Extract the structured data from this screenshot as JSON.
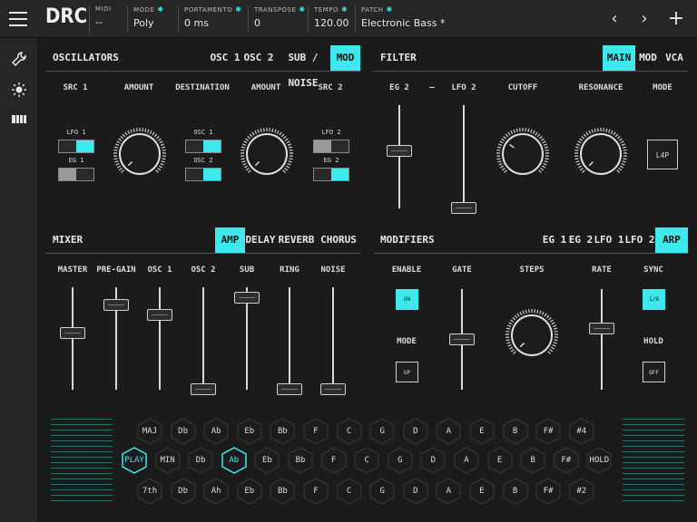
{
  "app": {
    "title": "DRC"
  },
  "header": {
    "fields": [
      {
        "label": "MIDI",
        "value": "--",
        "gear": false
      },
      {
        "label": "MODE",
        "value": "Poly",
        "gear": true
      },
      {
        "label": "PORTAMENTO",
        "value": "0 ms",
        "gear": true
      },
      {
        "label": "TRANSPOSE",
        "value": "0",
        "gear": true
      },
      {
        "label": "TEMPO",
        "value": "120.00",
        "gear": true
      },
      {
        "label": "PATCH",
        "value": "Electronic Bass *",
        "gear": true
      }
    ],
    "nav": {
      "prev": "‹",
      "next": "›",
      "add": "+"
    }
  },
  "sidebar": {
    "icons": [
      "wrench-icon",
      "brightness-icon",
      "piano-keys-icon"
    ]
  },
  "oscillators": {
    "title": "OSCILLATORS",
    "tabs": [
      "OSC 1",
      "OSC 2",
      "SUB / NOISE",
      "MOD"
    ],
    "active_tab": "MOD",
    "columns": [
      "SRC 1",
      "AMOUNT",
      "DESTINATION",
      "AMOUNT",
      "SRC 2"
    ],
    "src1": [
      {
        "label": "LFO 1",
        "on": true
      },
      {
        "label": "EG 1",
        "on": false
      }
    ],
    "dest": [
      {
        "label": "OSC 1",
        "on": true
      },
      {
        "label": "OSC 2",
        "on": true
      }
    ],
    "src2": [
      {
        "label": "LFO 2",
        "on": false
      },
      {
        "label": "EG 2",
        "on": true
      }
    ],
    "amount1": 0.0,
    "amount2": 0.0
  },
  "filter": {
    "title": "FILTER",
    "tabs": [
      "MAIN",
      "MOD",
      "VCA"
    ],
    "active_tab": "MAIN",
    "columns": [
      "EG 2",
      "—",
      "LFO 2",
      "CUTOFF",
      "RESONANCE",
      "MODE"
    ],
    "eg2": 0.55,
    "lfo2": 0.0,
    "cutoff": 0.3,
    "resonance": 0.0,
    "mode": "L4P"
  },
  "mixer": {
    "title": "MIXER",
    "tabs": [
      "AMP",
      "DELAY",
      "REVERB",
      "CHORUS"
    ],
    "active_tab": "AMP",
    "channels": [
      {
        "label": "MASTER",
        "value": 0.55
      },
      {
        "label": "PRE-GAIN",
        "value": 0.82
      },
      {
        "label": "OSC 1",
        "value": 0.73
      },
      {
        "label": "OSC 2",
        "value": 0.0
      },
      {
        "label": "SUB",
        "value": 0.89
      },
      {
        "label": "RING",
        "value": 0.0
      },
      {
        "label": "NOISE",
        "value": 0.0
      }
    ]
  },
  "modifiers": {
    "title": "MODIFIERS",
    "tabs": [
      "EG 1",
      "EG 2",
      "LFO 1",
      "LFO 2",
      "ARP"
    ],
    "active_tab": "ARP",
    "columns": [
      "ENABLE",
      "GATE",
      "STEPS",
      "RATE",
      "SYNC"
    ],
    "enable": {
      "label": "ON",
      "on": true
    },
    "mode_label": "MODE",
    "mode": {
      "label": "UP",
      "on": false
    },
    "gate": 0.5,
    "steps": 0.0,
    "rate": 0.6,
    "sync": {
      "label": "1/8",
      "on": true
    },
    "hold_label": "HOLD",
    "hold": {
      "label": "OFF",
      "on": false
    }
  },
  "keyboard": {
    "rows": [
      {
        "keys": [
          "MAJ",
          "Db",
          "Ab",
          "Eb",
          "Bb",
          "F",
          "C",
          "G",
          "D",
          "A",
          "E",
          "B",
          "F#",
          "#4"
        ],
        "active": []
      },
      {
        "keys": [
          "PLAY",
          "MIN",
          "Db",
          "Ab",
          "Eb",
          "Bb",
          "F",
          "C",
          "G",
          "D",
          "A",
          "E",
          "B",
          "F#",
          "HOLD"
        ],
        "active": [
          0,
          3
        ]
      },
      {
        "keys": [
          "7th",
          "Db",
          "Ah",
          "Eb",
          "Bb",
          "F",
          "C",
          "G",
          "D",
          "A",
          "E",
          "B",
          "F#",
          "#2"
        ],
        "active": []
      }
    ]
  },
  "colors": {
    "accent": "#3fe8ec",
    "background": "#1b1b1b",
    "bar": "#262626"
  }
}
